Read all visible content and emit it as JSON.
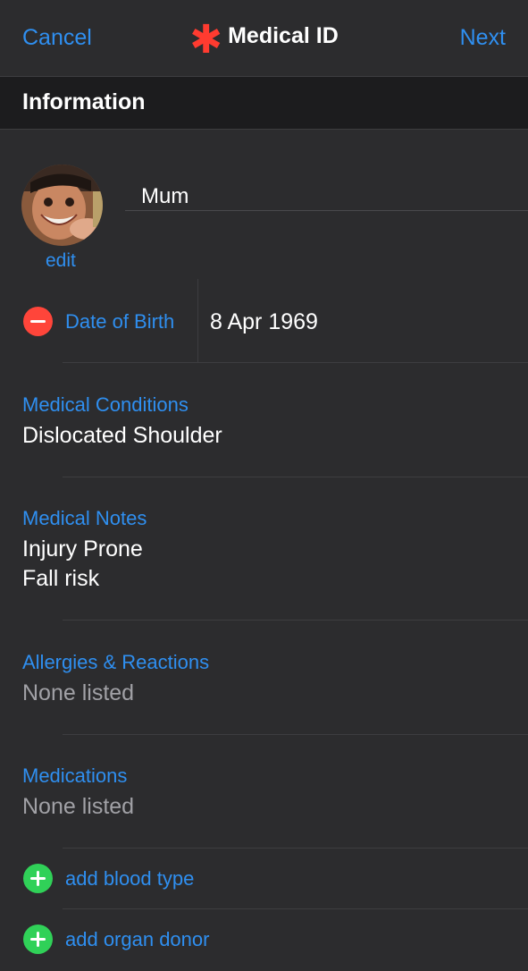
{
  "nav": {
    "cancel_label": "Cancel",
    "title": "Medical ID",
    "next_label": "Next",
    "title_symbol": "✱"
  },
  "section": {
    "title": "Information"
  },
  "profile": {
    "name": "Mum",
    "edit_label": "edit"
  },
  "date_of_birth": {
    "label": "Date of Birth",
    "value": "8 Apr 1969"
  },
  "medical_conditions": {
    "label": "Medical Conditions",
    "value": "Dislocated Shoulder"
  },
  "medical_notes": {
    "label": "Medical Notes",
    "lines": [
      "Injury Prone",
      "Fall risk"
    ]
  },
  "allergies": {
    "label": "Allergies & Reactions",
    "value": "None listed"
  },
  "medications": {
    "label": "Medications",
    "value": "None listed"
  },
  "add_blood_type": {
    "label": "add blood type"
  },
  "add_organ_donor": {
    "label": "add organ donor"
  },
  "colors": {
    "background": "#2c2c2e",
    "header_band": "#1c1c1e",
    "accent_blue": "#2f8ff0",
    "delete_red": "#ff453a",
    "add_green": "#30d158",
    "star_red": "#ff3b30",
    "placeholder_gray": "#a1a1a6"
  },
  "icons": {
    "title": "medical-star-icon",
    "remove": "minus-circle-icon",
    "add": "plus-circle-icon"
  }
}
